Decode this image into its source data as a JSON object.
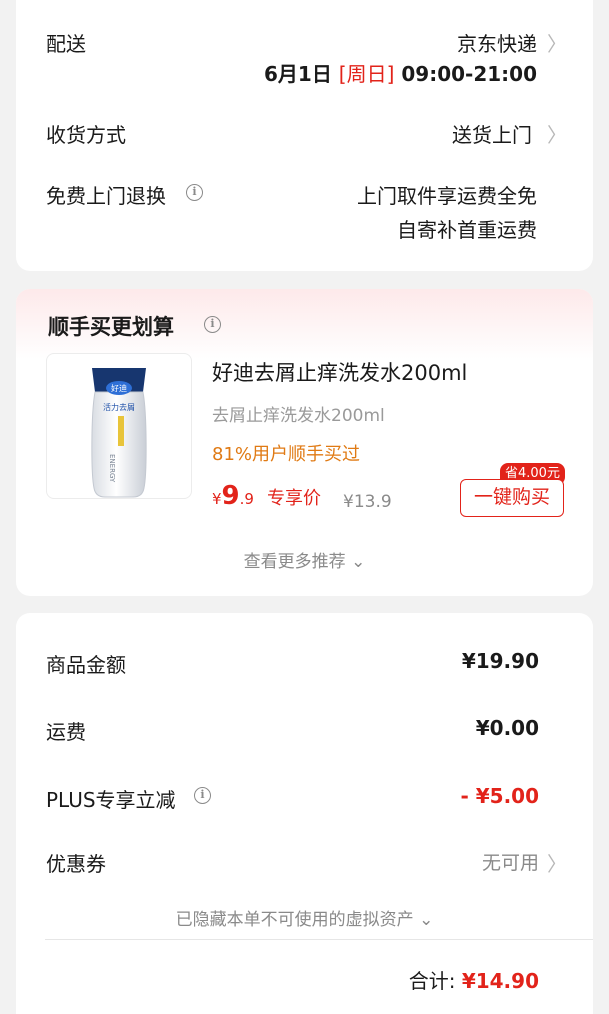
{
  "delivery": {
    "delivery_label": "配送",
    "carrier": "京东快递",
    "date_prefix": "6月1日",
    "weekday": "[周日]",
    "time_range": "09:00-21:00",
    "receive_label": "收货方式",
    "receive_value": "送货上门",
    "return_label": "免费上门退换",
    "return_line1": "上门取件享运费全免",
    "return_line2": "自寄补首重运费",
    "chevron": "〉",
    "info_glyph": "i"
  },
  "recommend": {
    "title": "顺手买更划算",
    "product_name": "好迪去屑止痒洗发水200ml",
    "product_sub": "去屑止痒洗发水200ml",
    "bought_rate": "81%用户顺手买过",
    "price_symbol": "¥",
    "price_int": "9",
    "price_dec": ".9",
    "exclusive_label": "专享价",
    "original_price": "¥13.9",
    "save_badge": "省4.00元",
    "buy_button": "一键购买",
    "more_link": "查看更多推荐",
    "more_arrow": "⌄",
    "bottle_brand": "好迪",
    "bottle_line": "活力去屑",
    "bottle_energy": "ENERGY"
  },
  "summary": {
    "goods_label": "商品金额",
    "goods_value": "¥19.90",
    "shipping_label": "运费",
    "shipping_value": "¥0.00",
    "plus_label": "PLUS专享立减",
    "plus_value": "- ¥5.00",
    "coupon_label": "优惠券",
    "coupon_value": "无可用",
    "hidden_assets": "已隐藏本单不可使用的虚拟资产",
    "total_label": "合计:",
    "total_value": "¥14.90"
  },
  "colors": {
    "accent": "#e2231a",
    "bg": "#f2f2f2",
    "secondary_text": "#8a8a8a"
  }
}
